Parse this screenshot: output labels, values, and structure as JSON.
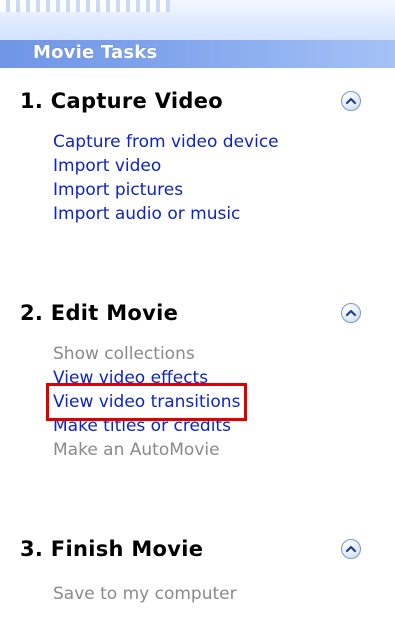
{
  "panel": {
    "title": "Movie Tasks"
  },
  "sections": [
    {
      "title": "1. Capture Video",
      "collapse_icon": "chevron-up-icon",
      "tasks": [
        {
          "label": "Capture from video device",
          "state": "enabled"
        },
        {
          "label": "Import video",
          "state": "enabled"
        },
        {
          "label": "Import pictures",
          "state": "enabled"
        },
        {
          "label": "Import audio or music",
          "state": "enabled"
        }
      ]
    },
    {
      "title": "2. Edit Movie",
      "collapse_icon": "chevron-up-icon",
      "tasks": [
        {
          "label": "Show collections",
          "state": "disabled"
        },
        {
          "label": "View video effects",
          "state": "enabled"
        },
        {
          "label": "View video transitions",
          "state": "enabled",
          "highlighted": true
        },
        {
          "label": "Make titles or credits",
          "state": "enabled"
        },
        {
          "label": "Make an AutoMovie",
          "state": "disabled"
        }
      ]
    },
    {
      "title": "3. Finish Movie",
      "collapse_icon": "chevron-up-icon",
      "tasks": [
        {
          "label": "Save to my computer",
          "state": "disabled"
        }
      ]
    }
  ],
  "colors": {
    "link": "#0d24c8",
    "disabled": "#8a8a8a",
    "highlight_box": "#e00000",
    "title_strip": "#7fa3ec"
  }
}
